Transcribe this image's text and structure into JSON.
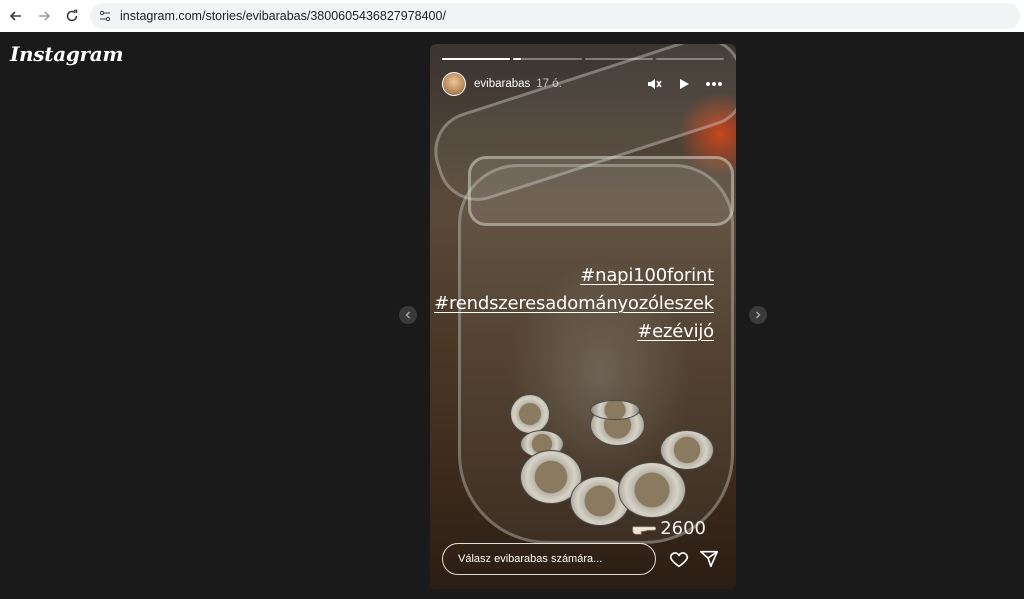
{
  "browser": {
    "url": "instagram.com/stories/evibarabas/3800605436827978400/"
  },
  "brand": {
    "logo_text": "Instagram"
  },
  "story": {
    "progress": [
      1.0,
      0.12,
      0.0,
      0.0
    ],
    "username": "evibarabas",
    "time": "17 ó.",
    "hashtags": [
      "#napi100forint",
      "#rendszeresadományozóleszek",
      "#ezévijó"
    ],
    "count": "2600",
    "count_icon": "pointing-hand-emoji",
    "reply_placeholder": "Válasz evibarabas számára..."
  },
  "colors": {
    "background": "#1a1a1a",
    "text": "#ffffff"
  }
}
